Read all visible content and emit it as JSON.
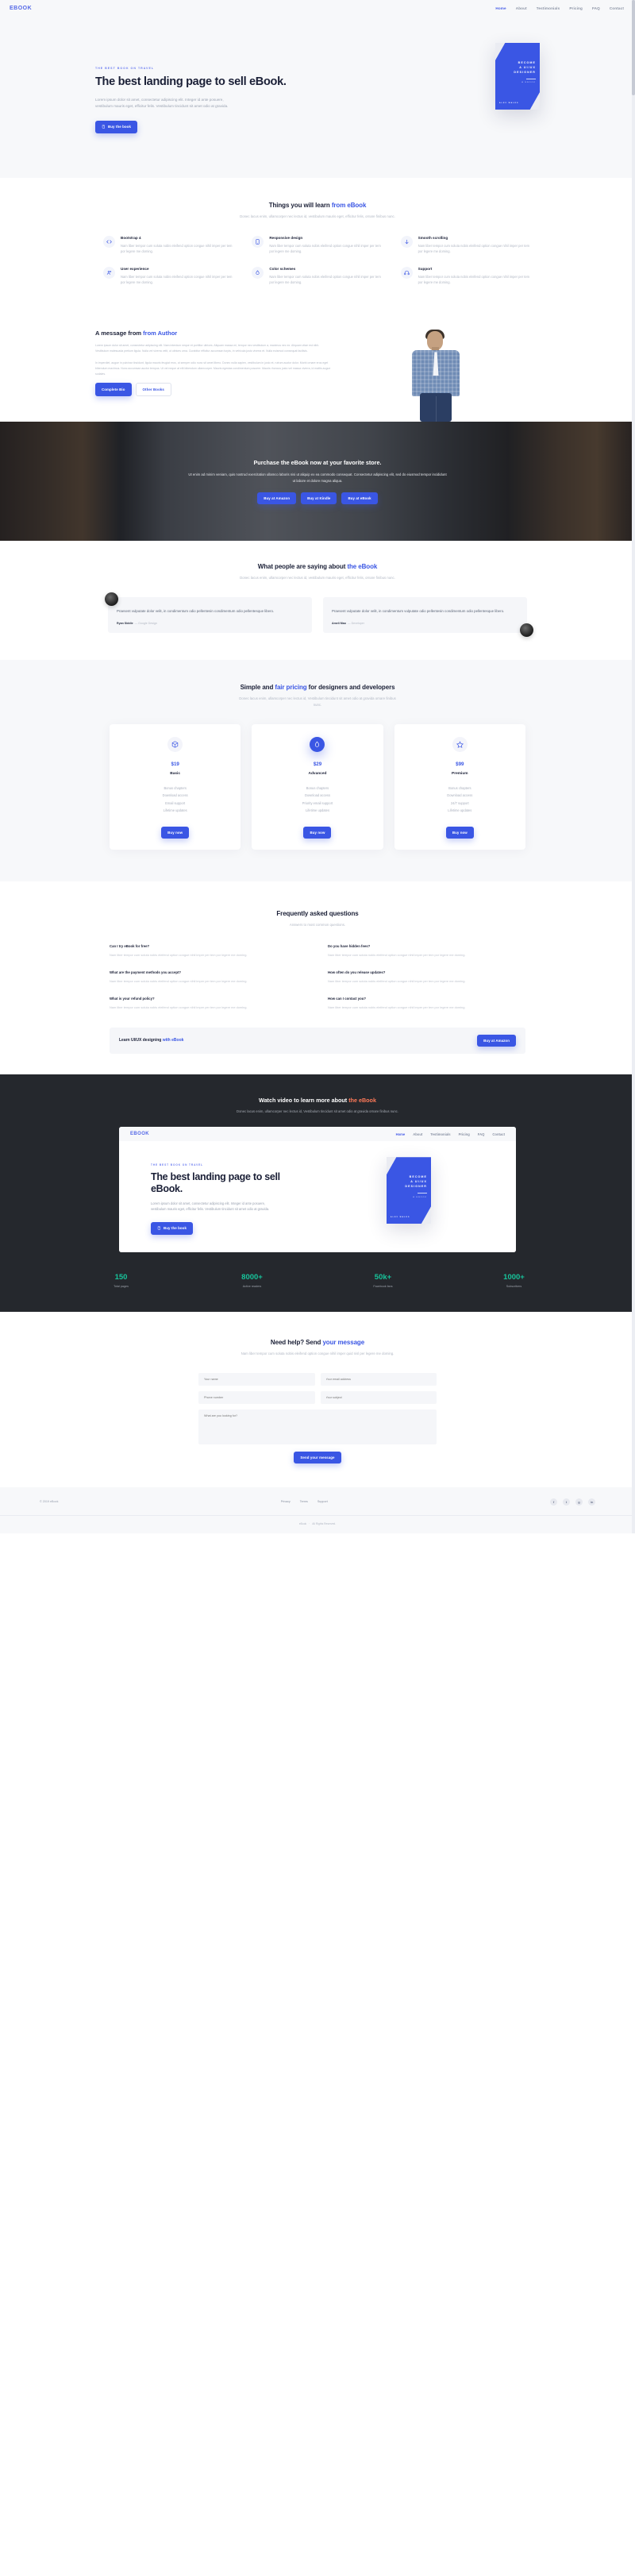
{
  "navbar": {
    "brand": "EBOOK",
    "links": [
      {
        "label": "Home",
        "active": true
      },
      {
        "label": "About",
        "active": false
      },
      {
        "label": "Testimonials",
        "active": false
      },
      {
        "label": "Pricing",
        "active": false
      },
      {
        "label": "FAQ",
        "active": false
      },
      {
        "label": "Contact",
        "active": false
      }
    ]
  },
  "hero": {
    "eyebrow": "THE BEST BOOK ON TRAVEL",
    "title": "The best landing page to sell eBook.",
    "subtitle": "Lorem ipsum dolor sit amet, consectetur adipiscing elit. Integer id ante posuere, vestibulum mauris eget, efficitur felis. Vestibulum tincidunt sit amet odio at gravida.",
    "cta_label": "Buy the book",
    "book": {
      "title": "BECOME A UI/UX DESIGNER",
      "line1": "BECOME",
      "line2": "A UI/UX",
      "line3": "DESIGNER",
      "kicker": "A EBOOK",
      "author": "ALEX WALES"
    }
  },
  "features": {
    "title_plain": "Things you will learn ",
    "title_accent": "from eBook",
    "subtitle": "Donec lacus enim, ullamcorper nec lectus id, vestibulum mauris eget, efficitur felis, ornare finibus nunc.",
    "items": [
      {
        "icon": "code-icon",
        "title": "Bootstrap 4",
        "text": "Nam liber tempor cum soluta nobis eleifend option congue nihil imper per tem por legere me doming."
      },
      {
        "icon": "mobile-icon",
        "title": "Responsive design",
        "text": "Nam liber tempor cum soluta nobis eleifend option congue nihil imper per tem por legere me doming."
      },
      {
        "icon": "arrow-down-icon",
        "title": "Smooth scrolling",
        "text": "Nam liber tempor cum soluta nobis eleifend option congue nihil imper per tem por legere me doming."
      },
      {
        "icon": "users-icon",
        "title": "User experience",
        "text": "Nam liber tempor cum soluta nobis eleifend option congue nihil imper per tem por legere me doming."
      },
      {
        "icon": "droplet-icon",
        "title": "Color schemes",
        "text": "Nam liber tempor cum soluta nobis eleifend option congue nihil imper per tem por legere me doming."
      },
      {
        "icon": "headphones-icon",
        "title": "Support",
        "text": "Nam liber tempor cum soluta nobis eleifend option congue nihil imper per tem por legere me doming."
      }
    ]
  },
  "author": {
    "title_plain": "A message from ",
    "title_accent": "from Author",
    "p1": "Lorem ipsum dolor sit amet, consectetur adipiscing elit. Nam interdum neque et porttitor ultrices. Aliquam massa mi, tempor nec vestibulum a, maximus nec ex. Aliquam vitae est nibh. Vestibulum malesuada pretium ligula. Nulla vel viverra velit, ut ultrices urna. Curabitur efficitur accumsan turpis, in vehicula justo viverra et. Nulla euismod consequat facilisis.",
    "p2": "In imperdiet, augue in pulvinar tincidunt, ligula mauris feugiat eros, ut semper odio nunc sit amet libero. Donec nulla sapien, vestibulum in justo et, rutrum auctor dolor. Morbi ornare eros eget bibendum maximus. Nunc accumsan auctor tempus. Ut vel neque at elit bibendum ullamcorper. Mauris egestas condimentum posuere. Mauris rhoncus justo vel massa viverra, id mattis augue sodales.",
    "btn_primary": "Complete Bio",
    "btn_secondary": "Other Books"
  },
  "purchase": {
    "title": "Purchase the eBook now at your favorite store.",
    "text": "Ut enim ad minim veniam, quis nostrud exercitation ullamco laboris nisi ut aliquip ex ea commodo consequat. Consectetur adipiscing elit, sed do eiusmod tempor incididunt ut labore et dolore magna aliqua.",
    "buttons": [
      "Buy at Amazon",
      "Buy at Kindle",
      "Buy at eBook"
    ]
  },
  "testimonials": {
    "title_plain": "What people are saying about ",
    "title_accent": "the eBook",
    "subtitle": "Donec lacus enim, ullamcorper nec lectus id, vestibulum mauris eget, efficitur felis, ornare finibus nunc.",
    "items": [
      {
        "text": "Praesent vulputate dolor velit, in condimentum odio pellentesin condimentum odio pellentesque libero.",
        "name": "Ryan Siddle",
        "role": "Google Design"
      },
      {
        "text": "Praesent vulputate dolor velit, in condimentum vulputate odio pellentesin condimentum odio pellentesque libero.",
        "name": "Ameli Mao",
        "role": "Developer"
      }
    ]
  },
  "pricing": {
    "title_before": "Simple and ",
    "title_accent": "fair pricing",
    "title_after": " for designers and developers",
    "subtitle": "Donec lacus enim, ullamcorper nec lectus id, Vestibulum tincidunt sit amet odio at gravida ornare finibus nunc.",
    "plans": [
      {
        "icon": "box-icon",
        "price": "$19",
        "name": "Basic",
        "features": [
          "Bonus chapters",
          "Download access",
          "Email support",
          "Lifetime updates"
        ],
        "cta": "Buy now",
        "featured": false
      },
      {
        "icon": "droplet-icon",
        "price": "$29",
        "name": "Advanced",
        "features": [
          "Bonus chapters",
          "Download access",
          "Priority email support",
          "Lifetime updates"
        ],
        "cta": "Buy now",
        "featured": true
      },
      {
        "icon": "star-icon",
        "price": "$99",
        "name": "Premium",
        "features": [
          "Bonus chapters",
          "Download access",
          "24/7 support",
          "Lifetime updates"
        ],
        "cta": "Buy now",
        "featured": false
      }
    ]
  },
  "faq": {
    "title": "Frequently asked questions",
    "subtitle": "Answers to most common questions.",
    "items": [
      {
        "q": "Can I try eBook for free?",
        "a": "Nam liber tempor cum soluta nobis eleifend option congue nihil imper per tem por legere me doming."
      },
      {
        "q": "Do you have hidden fees?",
        "a": "Nam liber tempor cum soluta nobis eleifend option congue nihil imper per tem por legere me doming."
      },
      {
        "q": "What are the payment methods you accept?",
        "a": "Nam liber tempor cum soluta nobis eleifend option congue nihil imper per tem por legere me doming."
      },
      {
        "q": "How often do you release updates?",
        "a": "Nam liber tempor cum soluta nobis eleifend option congue nihil imper per tem por legere me doming."
      },
      {
        "q": "What is your refund policy?",
        "a": "Nam liber tempor cum soluta nobis eleifend option congue nihil imper per tem por legere me doming."
      },
      {
        "q": "How can I contact you?",
        "a": "Nam liber tempor cum soluta nobis eleifend option congue nihil imper per tem por legere me doming."
      }
    ],
    "banner_plain": "Learn UI/UX designing ",
    "banner_accent": "with eBook",
    "banner_cta": "Buy at Amazon"
  },
  "video": {
    "title_plain": "Watch video to learn more about ",
    "title_accent": "the eBook",
    "subtitle": "Donec lacus enim, ullamcorper nec lectus id, Vestibulum tincidunt sit amet odio at gravida ornare finibus nunc.",
    "preview": {
      "brand": "EBOOK",
      "links": [
        {
          "label": "Home",
          "active": true
        },
        {
          "label": "About",
          "active": false
        },
        {
          "label": "Testimonials",
          "active": false
        },
        {
          "label": "Pricing",
          "active": false
        },
        {
          "label": "FAQ",
          "active": false
        },
        {
          "label": "Contact",
          "active": false
        }
      ],
      "eyebrow": "THE BEST BOOK ON TRAVEL",
      "title": "The best landing page to sell eBook.",
      "subtitle": "Lorem ipsum dolor sit amet, consectetur adipiscing elit. Integer id ante posuere, vestibulum mauris eget, efficitur felis. Vestibulum tincidunt sit amet odio at gravida.",
      "cta_label": "Buy the book",
      "book": {
        "line1": "BECOME",
        "line2": "A UI/UX",
        "line3": "DESIGNER",
        "kicker": "A EBOOK",
        "author": "ALEX WALES"
      }
    }
  },
  "stats": [
    {
      "value": "150",
      "label": "Total pages"
    },
    {
      "value": "8000+",
      "label": "Active readers"
    },
    {
      "value": "50k+",
      "label": "Facebook fans"
    },
    {
      "value": "1000+",
      "label": "Subscribers"
    }
  ],
  "contact": {
    "title_plain": "Need help? Send ",
    "title_accent": "your message",
    "subtitle": "Nam liber tempor cum soluta nobis eleifend option congue nihil imper quid nisl per legere me doming.",
    "fields": {
      "name": "Your name",
      "email": "Your email address",
      "phone": "Phone number",
      "subject": "Your subject",
      "message": "What are you looking for?"
    },
    "submit_label": "Send your message"
  },
  "footer": {
    "copyright": "© 2019 eBook",
    "links": [
      "Privacy",
      "Terms",
      "Support"
    ],
    "socials": [
      "facebook-icon",
      "twitter-icon",
      "google-plus-icon",
      "linkedin-icon"
    ],
    "bottom_left": "eBook",
    "bottom_right": "All Rights Reserved."
  },
  "colors": {
    "accent": "#3a56e4",
    "dark": "#25282d",
    "green": "#17c39a",
    "orange": "#ff7a59",
    "light_bg": "#f7f8fa"
  }
}
